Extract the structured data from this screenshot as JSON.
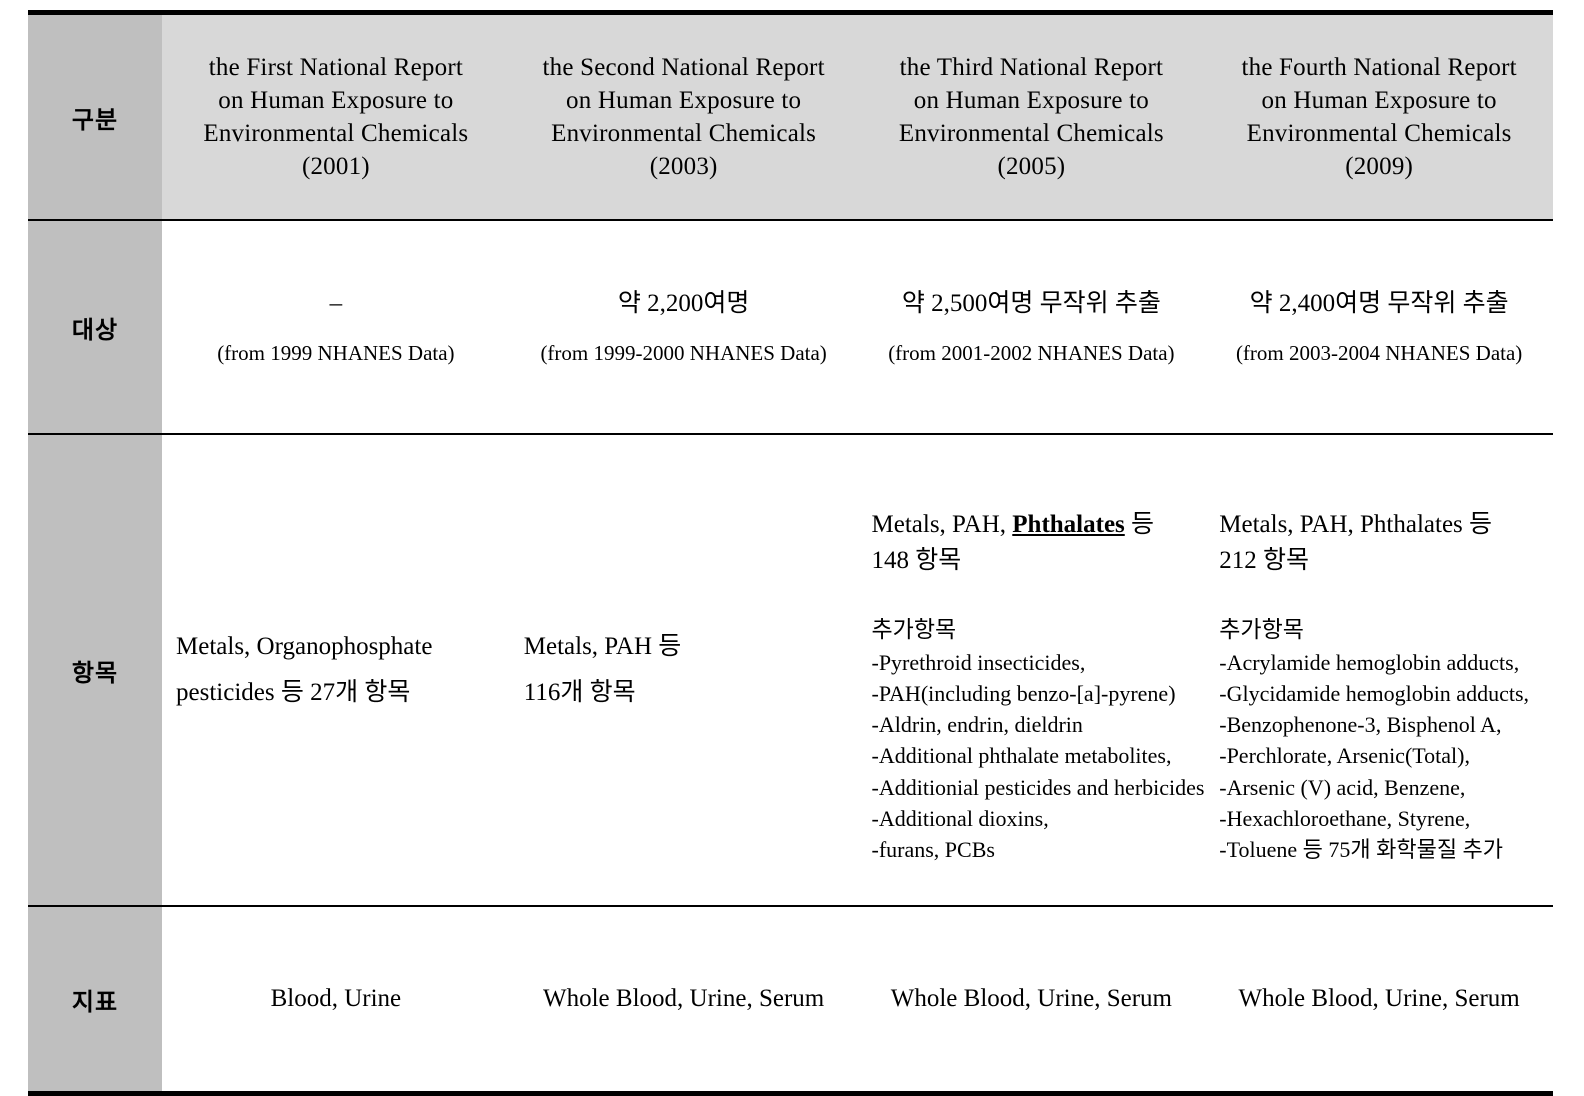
{
  "table": {
    "colors": {
      "label_cell_bg": "#bfbfbf",
      "header_cell_bg": "#d8d8d8",
      "border": "#000000",
      "text": "#000000"
    },
    "row_labels": {
      "header": "구분",
      "target": "대상",
      "items": "항목",
      "index": "지표"
    },
    "columns": [
      {
        "id": "report1",
        "title_line1": "the First National Report",
        "title_line2": "on Human Exposure to",
        "title_line3": "Environmental Chemicals",
        "title_year": "(2001)"
      },
      {
        "id": "report2",
        "title_line1": "the Second National Report",
        "title_line2": "on Human Exposure to",
        "title_line3": "Environmental Chemicals",
        "title_year": "(2003)"
      },
      {
        "id": "report3",
        "title_line1": "the Third National Report",
        "title_line2": "on Human Exposure to",
        "title_line3": "Environmental Chemicals",
        "title_year": "(2005)"
      },
      {
        "id": "report4",
        "title_line1": "the Fourth National Report",
        "title_line2": "on Human Exposure to",
        "title_line3": "Environmental Chemicals",
        "title_year": "(2009)"
      }
    ],
    "target_row": [
      {
        "main": "–",
        "source": "(from 1999 NHANES Data)"
      },
      {
        "main": "약 2,200여명",
        "source": "(from 1999-2000 NHANES Data)"
      },
      {
        "main": "약 2,500여명 무작위 추출",
        "source": "(from 2001-2002 NHANES Data)"
      },
      {
        "main": "약 2,400여명 무작위 추출",
        "source": "(from 2003-2004 NHANES Data)"
      }
    ],
    "items_row": [
      {
        "summary_line1": "Metals, Organophosphate",
        "summary_line2": "pesticides 등 27개 항목",
        "additional_heading": "",
        "additional": []
      },
      {
        "summary_line1": "Metals, PAH 등",
        "summary_line2": "116개 항목",
        "additional_heading": "",
        "additional": []
      },
      {
        "summary_pre": "Metals, PAH, ",
        "summary_highlight": "Phthalates",
        "summary_post": " 등",
        "summary_line2": "148 항목",
        "additional_heading": "추가항목",
        "additional": [
          "-Pyrethroid insecticides,",
          "-PAH(including benzo-[a]-pyrene)",
          "-Aldrin, endrin, dieldrin",
          "-Additional phthalate metabolites,",
          "-Additionial pesticides and herbicides",
          "-Additional dioxins,",
          "-furans, PCBs"
        ]
      },
      {
        "summary_pre": "Metals, PAH, ",
        "summary_highlight": "",
        "summary_post": "Phthalates 등",
        "summary_line2": "212 항목",
        "additional_heading": "추가항목",
        "additional": [
          "-Acrylamide hemoglobin adducts,",
          "-Glycidamide hemoglobin adducts,",
          "-Benzophenone-3, Bisphenol A,",
          "-Perchlorate, Arsenic(Total),",
          "-Arsenic (V) acid, Benzene,",
          "-Hexachloroethane, Styrene,",
          "-Toluene 등 75개 화학물질 추가"
        ]
      }
    ],
    "index_row": [
      "Blood, Urine",
      "Whole Blood, Urine, Serum",
      "Whole Blood, Urine, Serum",
      "Whole Blood, Urine, Serum"
    ]
  }
}
